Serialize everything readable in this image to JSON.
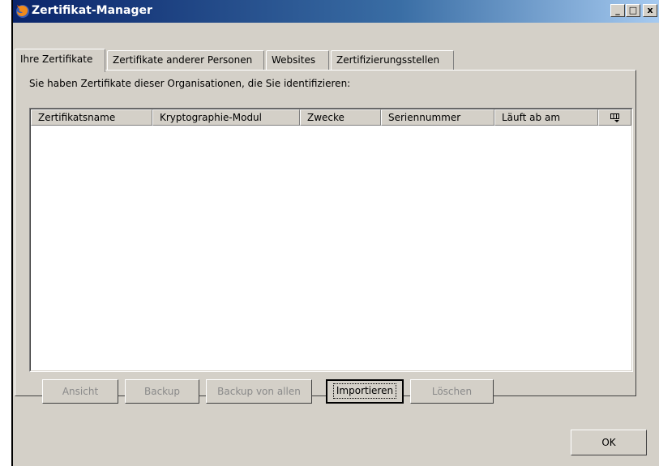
{
  "window": {
    "title": "Zertifikat-Manager"
  },
  "titlebar_buttons": {
    "minimize": "_",
    "maximize": "□",
    "close": "x"
  },
  "tabs": [
    {
      "label": "Ihre Zertifikate",
      "active": true
    },
    {
      "label": "Zertifikate anderer Personen",
      "active": false
    },
    {
      "label": "Websites",
      "active": false
    },
    {
      "label": "Zertifizierungsstellen",
      "active": false
    }
  ],
  "description": "Sie haben Zertifikate dieser Organisationen, die Sie identifizieren:",
  "table": {
    "columns": [
      "Zertifikatsname",
      "Kryptographie-Modul",
      "Zwecke",
      "Seriennummer",
      "Läuft ab am"
    ],
    "column_picker_icon": "column-picker-icon",
    "rows": []
  },
  "buttons": [
    {
      "label": "Ansicht",
      "enabled": false
    },
    {
      "label": "Backup",
      "enabled": false
    },
    {
      "label": "Backup von allen",
      "enabled": false
    },
    {
      "label": "Importieren",
      "enabled": true,
      "default": true
    },
    {
      "label": "Löschen",
      "enabled": false
    }
  ],
  "ok_label": "OK",
  "icons": {
    "app": "firefox-icon"
  }
}
